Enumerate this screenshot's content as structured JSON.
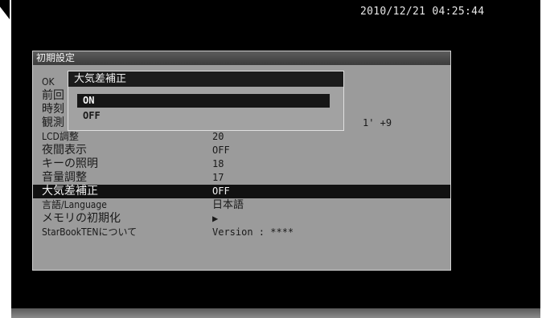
{
  "status_bar": {
    "datetime": "2010/12/21 04:25:44"
  },
  "panel": {
    "title": "初期設定",
    "rows": [
      {
        "label": "OK",
        "value": ""
      },
      {
        "label": "前回",
        "value": ""
      },
      {
        "label": "時刻",
        "value": ""
      },
      {
        "label": "観測",
        "value": ""
      },
      {
        "label": "LCD調整",
        "value": "20"
      },
      {
        "label": "夜間表示",
        "value": "OFF"
      },
      {
        "label": "キーの照明",
        "value": "18"
      },
      {
        "label": "音量調整",
        "value": "17"
      },
      {
        "label": "大気差補正",
        "value": "OFF"
      },
      {
        "label": "言語/Language",
        "value": "日本語"
      },
      {
        "label": "メモリの初期化",
        "value": "▶"
      },
      {
        "label": "StarBookTENについて",
        "value": "Version : ****"
      }
    ],
    "partial_observation_value": "1' +9",
    "selected_index": 8
  },
  "popup": {
    "title": "大気差補正",
    "options": [
      "ON",
      "OFF"
    ],
    "selected_option": "ON"
  }
}
